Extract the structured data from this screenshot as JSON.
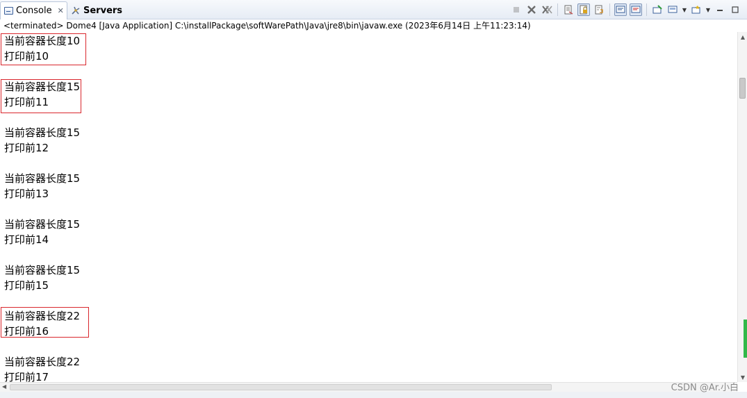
{
  "tabs": [
    {
      "label": "Console",
      "active": true,
      "close": "✕",
      "icon": "console-icon"
    },
    {
      "label": "Servers",
      "active": false,
      "icon": "servers-icon"
    }
  ],
  "toolbar": {
    "icons": [
      "terminate-icon",
      "remove-launch-icon",
      "remove-all-terminated-icon",
      "clear-console-icon",
      "scroll-lock-icon",
      "word-wrap-icon",
      "show-on-stdout-icon",
      "show-on-stderr-icon",
      "pin-console-icon",
      "display-console-icon",
      "open-console-icon",
      "minimize-icon",
      "maximize-icon"
    ]
  },
  "status_line": "<terminated> Dome4 [Java Application] C:\\installPackage\\softWarePath\\Java\\jre8\\bin\\javaw.exe (2023年6月14日 上午11:23:14)",
  "output": {
    "lines": [
      "当前容器长度10",
      "打印前10",
      "",
      "当前容器长度15",
      "打印前11",
      "",
      "当前容器长度15",
      "打印前12",
      "",
      "当前容器长度15",
      "打印前13",
      "",
      "当前容器长度15",
      "打印前14",
      "",
      "当前容器长度15",
      "打印前15",
      "",
      "当前容器长度22",
      "打印前16",
      "",
      "当前容器长度22",
      "打印前17"
    ],
    "highlight_color": "#d9262c"
  },
  "watermark": "CSDN @Ar.小白",
  "colors": {
    "accent_green": "#31b949",
    "tab_border": "#b9c6da"
  }
}
